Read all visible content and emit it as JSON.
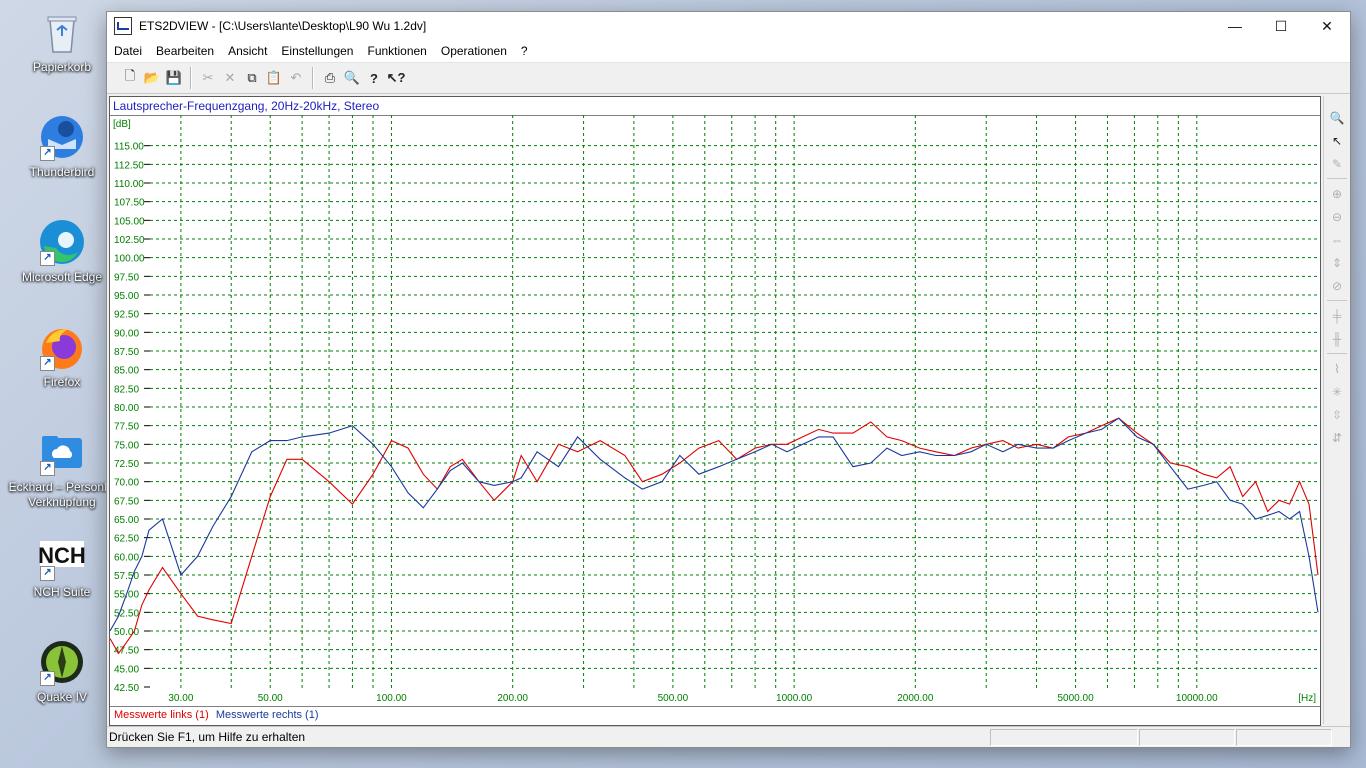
{
  "desktop": {
    "icons": [
      {
        "label": "Papierkorb"
      },
      {
        "label": "Thunderbird"
      },
      {
        "label": "Microsoft Edge"
      },
      {
        "label": "Firefox"
      },
      {
        "label": "Eckhard – Personlic Verknüpfung"
      },
      {
        "label": "NCH Suite"
      },
      {
        "label": "Quake IV"
      }
    ]
  },
  "window": {
    "title": "ETS2DVIEW - [C:\\Users\\lante\\Desktop\\L90 Wu 1.2dv]",
    "minimize_glyph": "—",
    "maximize_glyph": "☐",
    "close_glyph": "✕"
  },
  "menu": {
    "items": [
      {
        "label": "Datei"
      },
      {
        "label": "Bearbeiten"
      },
      {
        "label": "Ansicht"
      },
      {
        "label": "Einstellungen"
      },
      {
        "label": "Funktionen"
      },
      {
        "label": "Operationen"
      },
      {
        "label": "?"
      }
    ]
  },
  "toolbar": {
    "icons": [
      "new-file-icon",
      "open-folder-icon",
      "save-icon",
      "cut-icon",
      "delete-icon",
      "copy-icon",
      "paste-icon",
      "undo-icon",
      "print-icon",
      "print-preview-icon",
      "help-icon",
      "context-help-icon"
    ]
  },
  "chart": {
    "title": "Lautsprecher-Frequenzgang, 20Hz-20kHz, Stereo",
    "legend": {
      "left": "Messwerte links (1)",
      "right": "Messwerte rechts (1)"
    }
  },
  "chart_data": {
    "type": "line",
    "title": "Lautsprecher-Frequenzgang, 20Hz-20kHz, Stereo",
    "xlabel": "[Hz]",
    "ylabel": "[dB]",
    "xscale": "log",
    "xlim": [
      20,
      20000
    ],
    "ylim": [
      42.5,
      117.5
    ],
    "x_ticks": [
      "30.00",
      "50.00",
      "100.00",
      "200.00",
      "500.00",
      "1000.00",
      "2000.00",
      "5000.00",
      "10000.00"
    ],
    "x_tick_values": [
      30,
      50,
      100,
      200,
      500,
      1000,
      2000,
      5000,
      10000
    ],
    "y_ticks": [
      "42.50",
      "45.00",
      "47.50",
      "50.00",
      "52.50",
      "55.00",
      "57.50",
      "60.00",
      "62.50",
      "65.00",
      "67.50",
      "70.00",
      "72.50",
      "75.00",
      "77.50",
      "80.00",
      "82.50",
      "85.00",
      "87.50",
      "90.00",
      "92.50",
      "95.00",
      "97.50",
      "100.00",
      "102.50",
      "105.00",
      "107.50",
      "110.00",
      "112.50",
      "115.00"
    ],
    "grid": true,
    "legend_position": "bottom-left",
    "colors": {
      "left": "#e00000",
      "right": "#1a3a9a",
      "grid": "#008000",
      "ticks": "#008000"
    },
    "series": [
      {
        "name": "Messwerte links (1)",
        "x": [
          20,
          21,
          22,
          23,
          24,
          25,
          27,
          30,
          33,
          36,
          40,
          45,
          50,
          55,
          60,
          70,
          80,
          90,
          100,
          110,
          120,
          130,
          140,
          150,
          165,
          180,
          200,
          210,
          230,
          260,
          290,
          330,
          380,
          420,
          470,
          520,
          580,
          650,
          720,
          800,
          880,
          960,
          1050,
          1150,
          1250,
          1400,
          1550,
          1700,
          1850,
          2050,
          2250,
          2500,
          2750,
          3000,
          3300,
          3600,
          4000,
          4400,
          4800,
          5300,
          5800,
          6400,
          7100,
          7800,
          8600,
          9500,
          10400,
          11200,
          12100,
          13000,
          14000,
          15000,
          16000,
          17000,
          18000,
          19000,
          20000
        ],
        "y": [
          49,
          47,
          48.5,
          50,
          53.5,
          55.5,
          58.5,
          55,
          52,
          51.5,
          51,
          60,
          68,
          73,
          73,
          70,
          67,
          71,
          75.5,
          74.5,
          71,
          69,
          72,
          73,
          70,
          67.5,
          70,
          73.5,
          70,
          75,
          74,
          75.5,
          73.5,
          70,
          71,
          72.5,
          74.5,
          75.5,
          73,
          74.5,
          75,
          75,
          76,
          77,
          76.5,
          76.5,
          78,
          76,
          75.5,
          74.5,
          74,
          73.5,
          74.5,
          75,
          75.5,
          74.5,
          75,
          74.5,
          76,
          76.5,
          77.5,
          78.5,
          76.5,
          75,
          72.5,
          72,
          71,
          70.5,
          72,
          68,
          70,
          66,
          67.5,
          67,
          70,
          67,
          57.5
        ]
      },
      {
        "name": "Messwerte rechts (1)",
        "x": [
          20,
          21,
          22,
          23,
          24,
          25,
          27,
          30,
          33,
          36,
          40,
          45,
          50,
          55,
          60,
          70,
          80,
          90,
          100,
          110,
          120,
          130,
          140,
          150,
          165,
          180,
          200,
          210,
          230,
          260,
          290,
          330,
          380,
          420,
          470,
          520,
          580,
          650,
          720,
          800,
          880,
          960,
          1050,
          1150,
          1250,
          1400,
          1550,
          1700,
          1850,
          2050,
          2250,
          2500,
          2750,
          3000,
          3300,
          3600,
          4000,
          4400,
          4800,
          5300,
          5800,
          6400,
          7100,
          7800,
          8600,
          9500,
          10400,
          11200,
          12100,
          13000,
          14000,
          15000,
          16000,
          17000,
          18000,
          19000,
          20000
        ],
        "y": [
          50,
          52,
          55,
          58,
          60,
          63.5,
          65,
          57.5,
          60,
          64,
          68,
          74,
          75.5,
          75.5,
          76,
          76.5,
          77.5,
          75,
          72,
          68.5,
          66.5,
          69,
          71.5,
          72.5,
          70,
          69.5,
          70,
          70.5,
          74,
          72,
          76,
          73,
          70.5,
          69,
          70,
          73.5,
          71,
          72,
          73,
          74,
          75,
          74,
          75,
          76,
          76,
          72,
          72.5,
          74.5,
          73.5,
          74,
          73.5,
          73.5,
          74,
          75,
          74,
          75,
          74.5,
          74.5,
          75.5,
          76.5,
          77,
          78.5,
          76,
          75,
          72,
          69,
          69.5,
          70,
          67.5,
          67,
          65,
          65.5,
          66,
          65,
          66,
          60,
          52.5
        ]
      }
    ]
  },
  "palette": {
    "icons": [
      "magnifier-icon",
      "cursor-icon",
      "pencil-icon",
      "zoom-in-icon",
      "zoom-out-icon",
      "zoom-x-icon",
      "zoom-y-icon",
      "zoom-reset-icon",
      "cursor-h-icon",
      "cursor-v-icon",
      "marker-icon",
      "scale-icon",
      "expand-y-icon",
      "shrink-y-icon"
    ]
  },
  "status": {
    "text": "Drücken Sie F1, um Hilfe zu erhalten"
  }
}
